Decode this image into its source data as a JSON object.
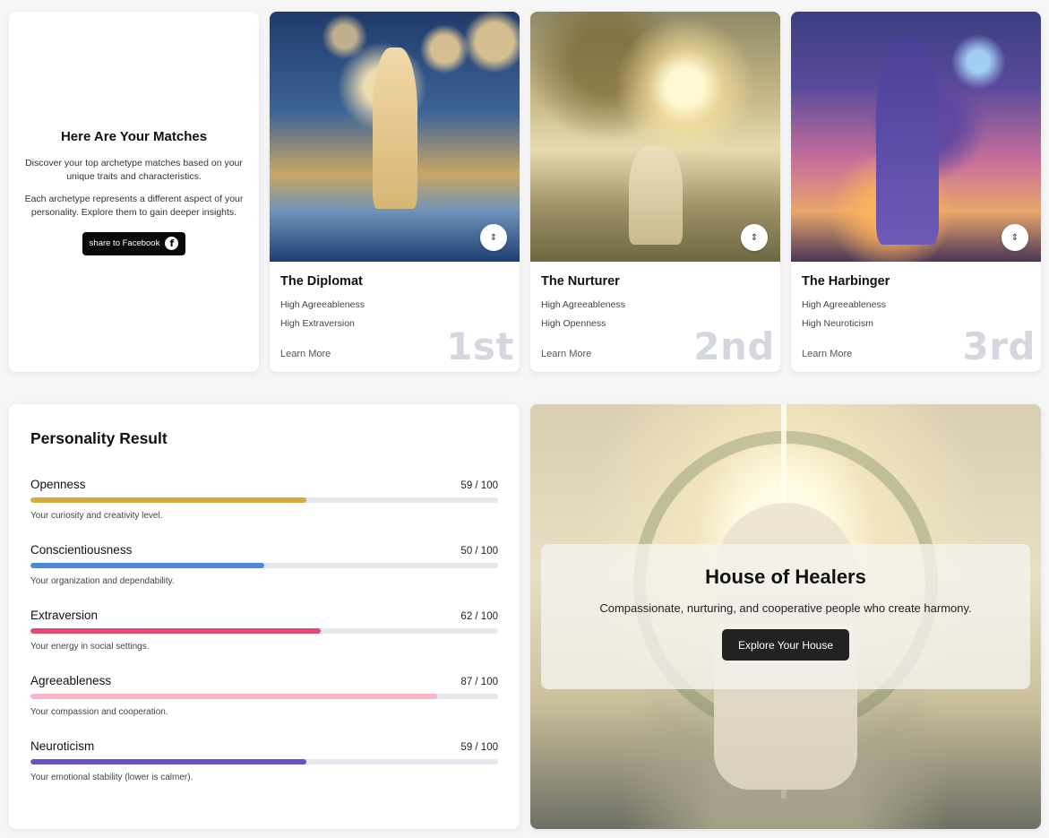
{
  "intro": {
    "title": "Here Are Your Matches",
    "paragraph1": "Discover your top archetype matches based on your unique traits and characteristics.",
    "paragraph2": "Each archetype represents a different aspect of your personality. Explore them to gain deeper insights.",
    "share_label": "share to Facebook"
  },
  "matches": [
    {
      "name": "The Diplomat",
      "traits": [
        "High Agreeableness",
        "High Extraversion"
      ],
      "learn_more": "Learn More",
      "rank": "1st"
    },
    {
      "name": "The Nurturer",
      "traits": [
        "High Agreeableness",
        "High Openness"
      ],
      "learn_more": "Learn More",
      "rank": "2nd"
    },
    {
      "name": "The Harbinger",
      "traits": [
        "High Agreeableness",
        "High Neuroticism"
      ],
      "learn_more": "Learn More",
      "rank": "3rd"
    }
  ],
  "personality": {
    "title": "Personality Result",
    "traits": [
      {
        "name": "Openness",
        "score": "59 / 100",
        "value": 59,
        "color": "#d6ad3c",
        "desc": "Your curiosity and creativity level."
      },
      {
        "name": "Conscientiousness",
        "score": "50 / 100",
        "value": 50,
        "color": "#4a8ad8",
        "desc": "Your organization and dependability."
      },
      {
        "name": "Extraversion",
        "score": "62 / 100",
        "value": 62,
        "color": "#e54b71",
        "desc": "Your energy in social settings."
      },
      {
        "name": "Agreeableness",
        "score": "87 / 100",
        "value": 87,
        "color": "#f7b6c4",
        "desc": "Your compassion and cooperation."
      },
      {
        "name": "Neuroticism",
        "score": "59 / 100",
        "value": 59,
        "color": "#6a52c2",
        "desc": "Your emotional stability (lower is calmer)."
      }
    ]
  },
  "house": {
    "title": "House of Healers",
    "description": "Compassionate, nurturing, and cooperative people who create harmony.",
    "button_label": "Explore Your House"
  }
}
